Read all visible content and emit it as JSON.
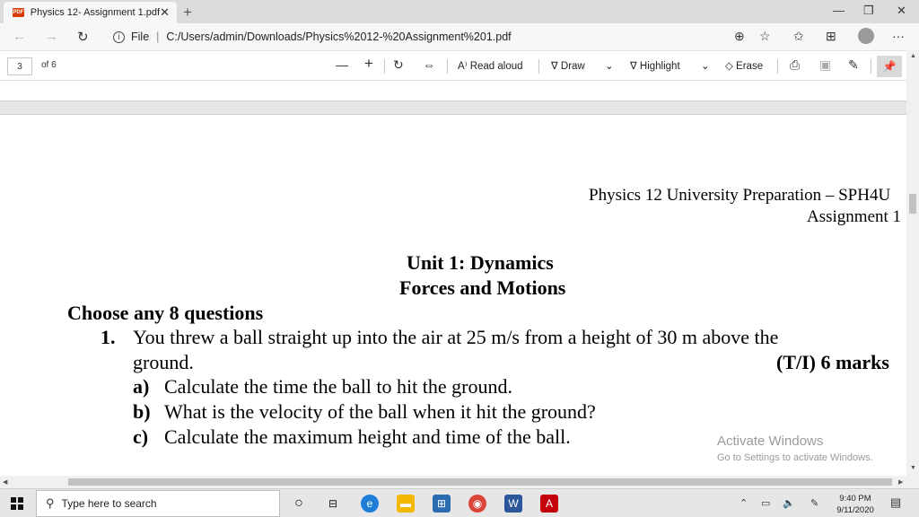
{
  "browser": {
    "tab_title": "Physics 12- Assignment 1.pdf",
    "pdf_badge": "PDF",
    "address_label": "File",
    "address_url": "C:/Users/admin/Downloads/Physics%2012-%20Assignment%201.pdf"
  },
  "pdf_toolbar": {
    "page_number": "3",
    "page_total": "of 6",
    "read_aloud": "Read aloud",
    "draw": "Draw",
    "highlight": "Highlight",
    "erase": "Erase"
  },
  "document": {
    "header_line1": "Physics 12 University Preparation – SPH4U",
    "header_line2": "Assignment 1",
    "unit_title": "Unit 1: Dynamics",
    "unit_subtitle": "Forces and Motions",
    "instruction": "Choose any 8 questions",
    "q1_number": "1.",
    "q1_text_line1": "You threw a ball straight up into the air at 25 m/s from a height of 30 m above the",
    "q1_text_line2": "ground.",
    "q1_marks": "(T/I) 6 marks",
    "parts": [
      {
        "label": "a)",
        "text": "Calculate the time the ball to hit the ground."
      },
      {
        "label": "b)",
        "text": "What is the velocity of the ball when it hit the ground?"
      },
      {
        "label": "c)",
        "text": "Calculate the maximum height and time of the ball."
      }
    ]
  },
  "watermark": {
    "title": "Activate Windows",
    "subtitle": "Go to Settings to activate Windows."
  },
  "taskbar": {
    "search_placeholder": "Type here to search",
    "time": "9:40 PM",
    "date": "9/11/2020"
  }
}
